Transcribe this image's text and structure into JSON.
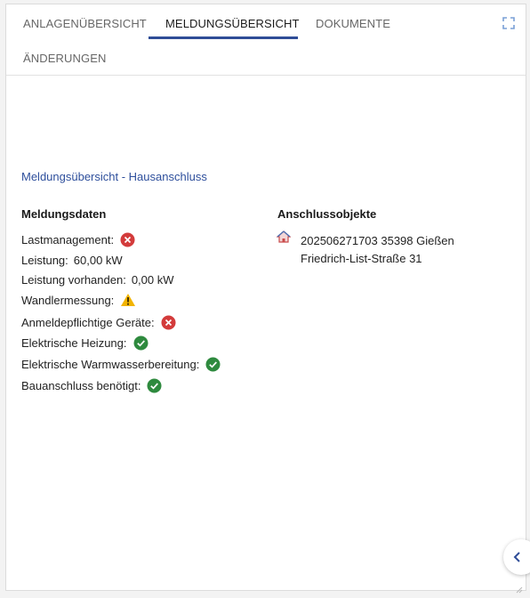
{
  "tabs": [
    {
      "label": "ANLAGENÜBERSICHT",
      "active": false
    },
    {
      "label": "MELDUNGSÜBERSICHT",
      "active": true
    },
    {
      "label": "DOKUMENTE",
      "active": false
    },
    {
      "label": "ÄNDERUNGEN",
      "active": false
    }
  ],
  "colors": {
    "accent": "#2f4d97",
    "link": "#2e4f9c",
    "error": "#d33b3b",
    "success": "#2e8a3e",
    "warning": "#f2b400"
  },
  "header": {
    "title": "Meldungsübersicht - Hausanschluss"
  },
  "meldungsdaten": {
    "title": "Meldungsdaten",
    "rows": [
      {
        "label": "Lastmanagement:",
        "value": "",
        "icon": "error-icon"
      },
      {
        "label": "Leistung:",
        "value": "60,00 kW",
        "icon": ""
      },
      {
        "label": "Leistung vorhanden:",
        "value": "0,00 kW",
        "icon": ""
      },
      {
        "label": "Wandlermessung:",
        "value": "",
        "icon": "warning-icon"
      },
      {
        "label": "Anmeldepflichtige Geräte:",
        "value": "",
        "icon": "error-icon"
      },
      {
        "label": "Elektrische Heizung:",
        "value": "",
        "icon": "check-icon"
      },
      {
        "label": "Elektrische Warmwasserbereitung:",
        "value": "",
        "icon": "check-icon"
      },
      {
        "label": "Bauanschluss benötigt:",
        "value": "",
        "icon": "check-icon"
      }
    ]
  },
  "anschlussobjekte": {
    "title": "Anschlussobjekte",
    "items": [
      {
        "icon": "house-icon",
        "text": "202506271703 35398 Gießen Friedrich-List-Straße 31"
      }
    ]
  }
}
